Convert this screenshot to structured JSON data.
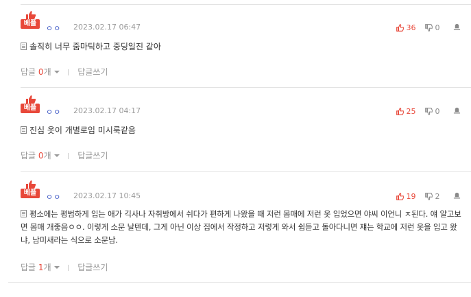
{
  "comments": [
    {
      "badge": "베플",
      "nick": "ㅇㅇ",
      "date": "2023.02.17 06:47",
      "up": "36",
      "down": "0",
      "text": "솔직히 너무 줌마틱하고 중딩일진 같아",
      "reply_label": "답글",
      "reply_count": "0",
      "reply_unit": "개",
      "write_label": "답글쓰기"
    },
    {
      "badge": "베플",
      "nick": "ㅇㅇ",
      "date": "2023.02.17 04:17",
      "up": "25",
      "down": "0",
      "text": "진심 옷이 개별로임 미시룩같음",
      "reply_label": "답글",
      "reply_count": "0",
      "reply_unit": "개",
      "write_label": "답글쓰기"
    },
    {
      "badge": "베플",
      "nick": "ㅇㅇ",
      "date": "2023.02.17 10:45",
      "up": "19",
      "down": "2",
      "text": "평소에는 평범하게 입는 애가 긱사나 자취방에서 쉬다가 편하게 나왔을 때 저런 몸매에 저런 옷 입었으면 야씨 이언니 ㅈ된다. 얘 알고보면 몸매 개좋음ㅇㅇ. 이렇게 소문 날텐데, 그게 아닌 이상 집에서 작정하고 저렇게 와서 쉽듣고 돌아다니면 쟤는 학교에 저런 옷을 입고 왔냐, 남미새라는 식으로 소문남.",
      "reply_label": "답글",
      "reply_count": "1",
      "reply_unit": "개",
      "write_label": "답글쓰기"
    }
  ],
  "colors": {
    "accent_red": "#e8483a",
    "nick_blue": "#3a55c4",
    "muted": "#9a9a9a"
  },
  "icons": {
    "badge_thumb": "thumbs-up-icon",
    "upvote": "thumbs-up-icon",
    "downvote": "thumbs-down-icon",
    "report": "alarm-icon",
    "doc": "document-icon",
    "caret": "chevron-down-icon"
  }
}
